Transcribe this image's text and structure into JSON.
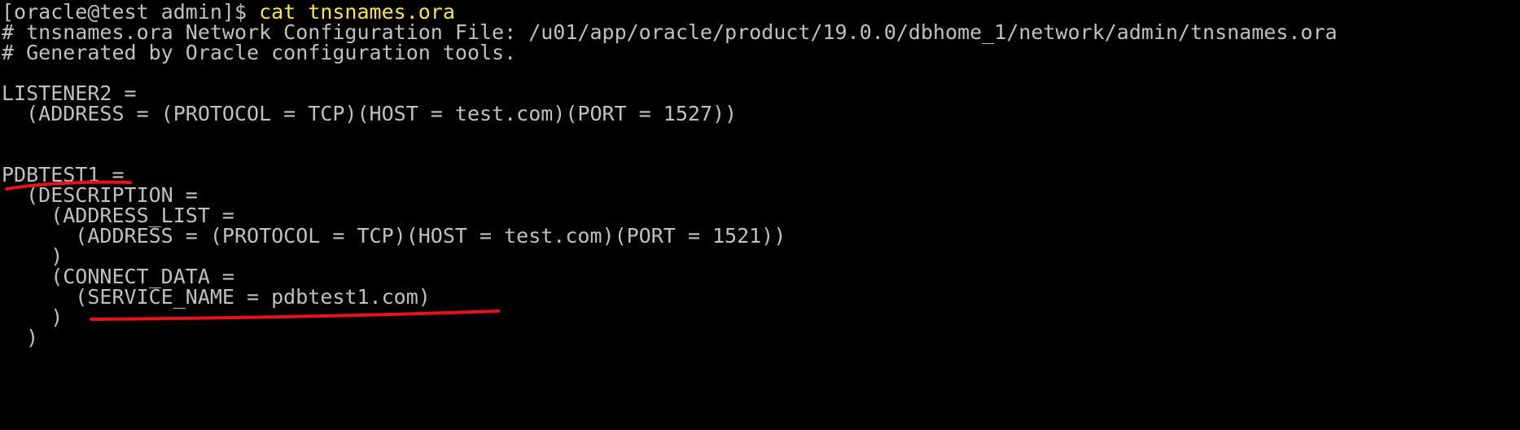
{
  "terminal": {
    "colors": {
      "background": "#000000",
      "text": "#c0c0c0",
      "command": "#f5e642",
      "annotation": "#e8121e"
    },
    "prompt": "[oracle@test admin]$ ",
    "command": "cat tnsnames.ora",
    "lines": [
      "# tnsnames.ora Network Configuration File: /u01/app/oracle/product/19.0.0/dbhome_1/network/admin/tnsnames.ora",
      "# Generated by Oracle configuration tools.",
      "",
      "LISTENER2 =",
      "  (ADDRESS = (PROTOCOL = TCP)(HOST = test.com)(PORT = 1527))",
      "",
      "",
      "PDBTEST1 =",
      "  (DESCRIPTION =",
      "    (ADDRESS_LIST =",
      "      (ADDRESS = (PROTOCOL = TCP)(HOST = test.com)(PORT = 1521))",
      "    )",
      "    (CONNECT_DATA =",
      "      (SERVICE_NAME = pdbtest1.com)",
      "    )",
      "  )"
    ]
  }
}
